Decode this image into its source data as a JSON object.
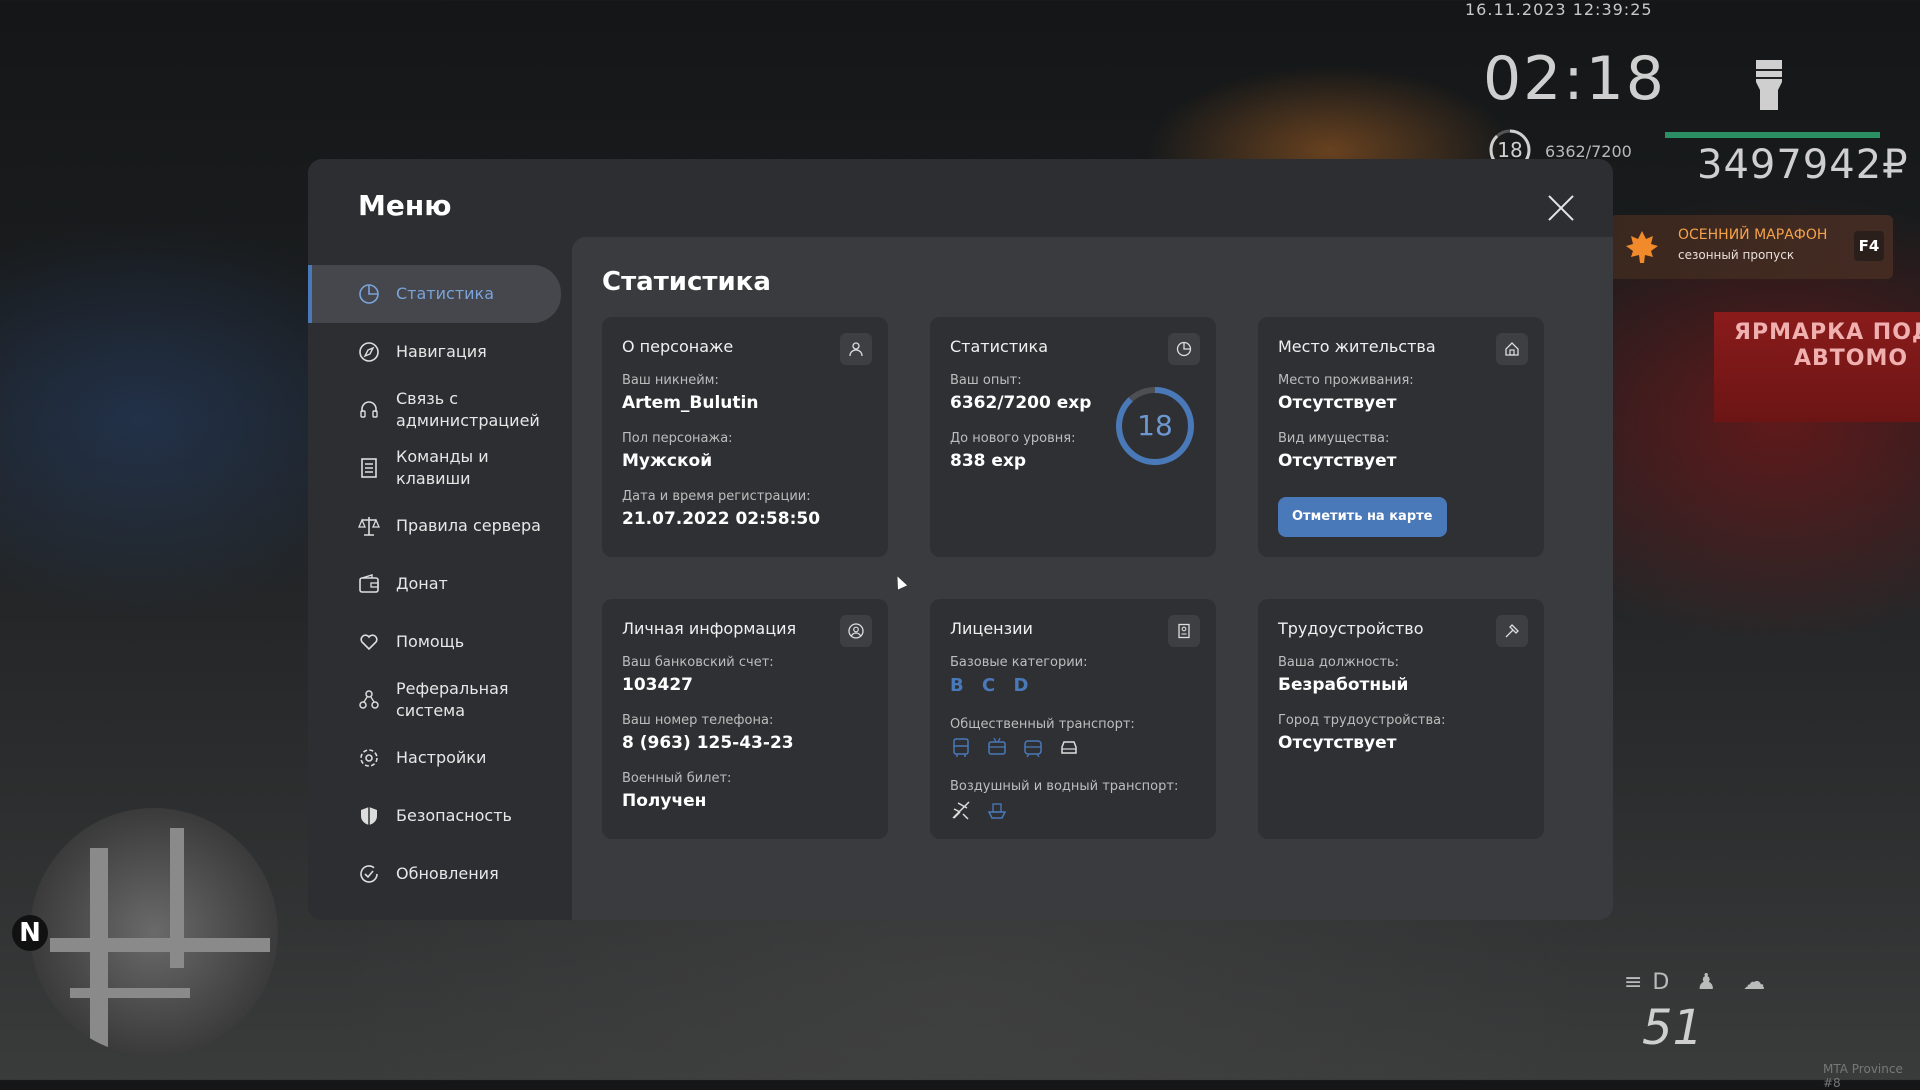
{
  "hud": {
    "datetime": "16.11.2023 12:39:25",
    "clock": "02:18",
    "level": "18",
    "exp": "6362/7200",
    "money": "3497942₽",
    "speed": "51",
    "watermark": "MTA Province #8",
    "compass": "N",
    "accent_bar_color": "#2a8f63"
  },
  "marathon": {
    "title": "ОСЕННИЙ МАРАФОН",
    "subtitle": "сезонный пропуск",
    "key": "F4"
  },
  "billboard": {
    "line1": "ЯРМАРКА ПОД",
    "line2": "АВТОМО"
  },
  "menu": {
    "title": "Меню",
    "accent_color": "#4a79b9",
    "nav": [
      {
        "label": "Статистика",
        "icon": "pie-chart-icon",
        "active": true
      },
      {
        "label": "Навигация",
        "icon": "compass-icon"
      },
      {
        "label": "Связь с администрацией",
        "icon": "headset-icon"
      },
      {
        "label": "Команды и клавиши",
        "icon": "document-icon"
      },
      {
        "label": "Правила сервера",
        "icon": "scales-icon"
      },
      {
        "label": "Донат",
        "icon": "wallet-icon"
      },
      {
        "label": "Помощь",
        "icon": "heart-hand-icon"
      },
      {
        "label": "Реферальная система",
        "icon": "people-network-icon"
      },
      {
        "label": "Настройки",
        "icon": "gear-icon"
      },
      {
        "label": "Безопасность",
        "icon": "shield-icon"
      },
      {
        "label": "Обновления",
        "icon": "refresh-check-icon"
      }
    ]
  },
  "content": {
    "title": "Статистика",
    "about": {
      "title": "О персонаже",
      "nick_label": "Ваш никнейм:",
      "nick": "Artem_Bulutin",
      "gender_label": "Пол персонажа:",
      "gender": "Мужской",
      "reg_label": "Дата и время регистрации:",
      "reg": "21.07.2022 02:58:50"
    },
    "stats": {
      "title": "Статистика",
      "exp_label": "Ваш опыт:",
      "exp": "6362/7200 exp",
      "next_label": "До нового уровня:",
      "next": "838 exp",
      "level": "18",
      "progress": 0.88
    },
    "residence": {
      "title": "Место жительства",
      "place_label": "Место проживания:",
      "place": "Отсутствует",
      "property_label": "Вид имущества:",
      "property": "Отсутствует",
      "map_button": "Отметить на карте"
    },
    "personal": {
      "title": "Личная информация",
      "bank_label": "Ваш банковский счет:",
      "bank": "103427",
      "phone_label": "Ваш номер телефона:",
      "phone": "8 (963) 125-43-23",
      "military_label": "Военный билет:",
      "military": "Получен"
    },
    "licenses": {
      "title": "Лицензии",
      "base_label": "Базовые категории:",
      "base": "B C D",
      "public_label": "Общественный транспорт:",
      "air_label": "Воздушный и водный транспорт:"
    },
    "job": {
      "title": "Трудоустройство",
      "position_label": "Ваша должность:",
      "position": "Безработный",
      "city_label": "Город трудоустройства:",
      "city": "Отсутствует"
    }
  }
}
